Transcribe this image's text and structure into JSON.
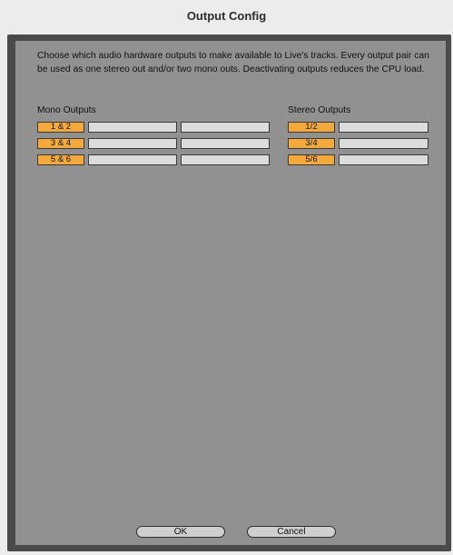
{
  "window": {
    "title": "Output Config"
  },
  "description": "Choose which audio hardware outputs to make available to Live's tracks. Every output pair can be used as one stereo out and/or two mono outs.  Deactivating outputs reduces the CPU load.",
  "mono": {
    "heading": "Mono Outputs",
    "rows": [
      {
        "label": "1 & 2"
      },
      {
        "label": "3 & 4"
      },
      {
        "label": "5 & 6"
      }
    ]
  },
  "stereo": {
    "heading": "Stereo Outputs",
    "rows": [
      {
        "label": "1/2"
      },
      {
        "label": "3/4"
      },
      {
        "label": "5/6"
      }
    ]
  },
  "buttons": {
    "ok": "OK",
    "cancel": "Cancel"
  },
  "colors": {
    "active_output": "#f5a93a",
    "inactive_output": "#dcdcdc",
    "panel": "#919191"
  }
}
